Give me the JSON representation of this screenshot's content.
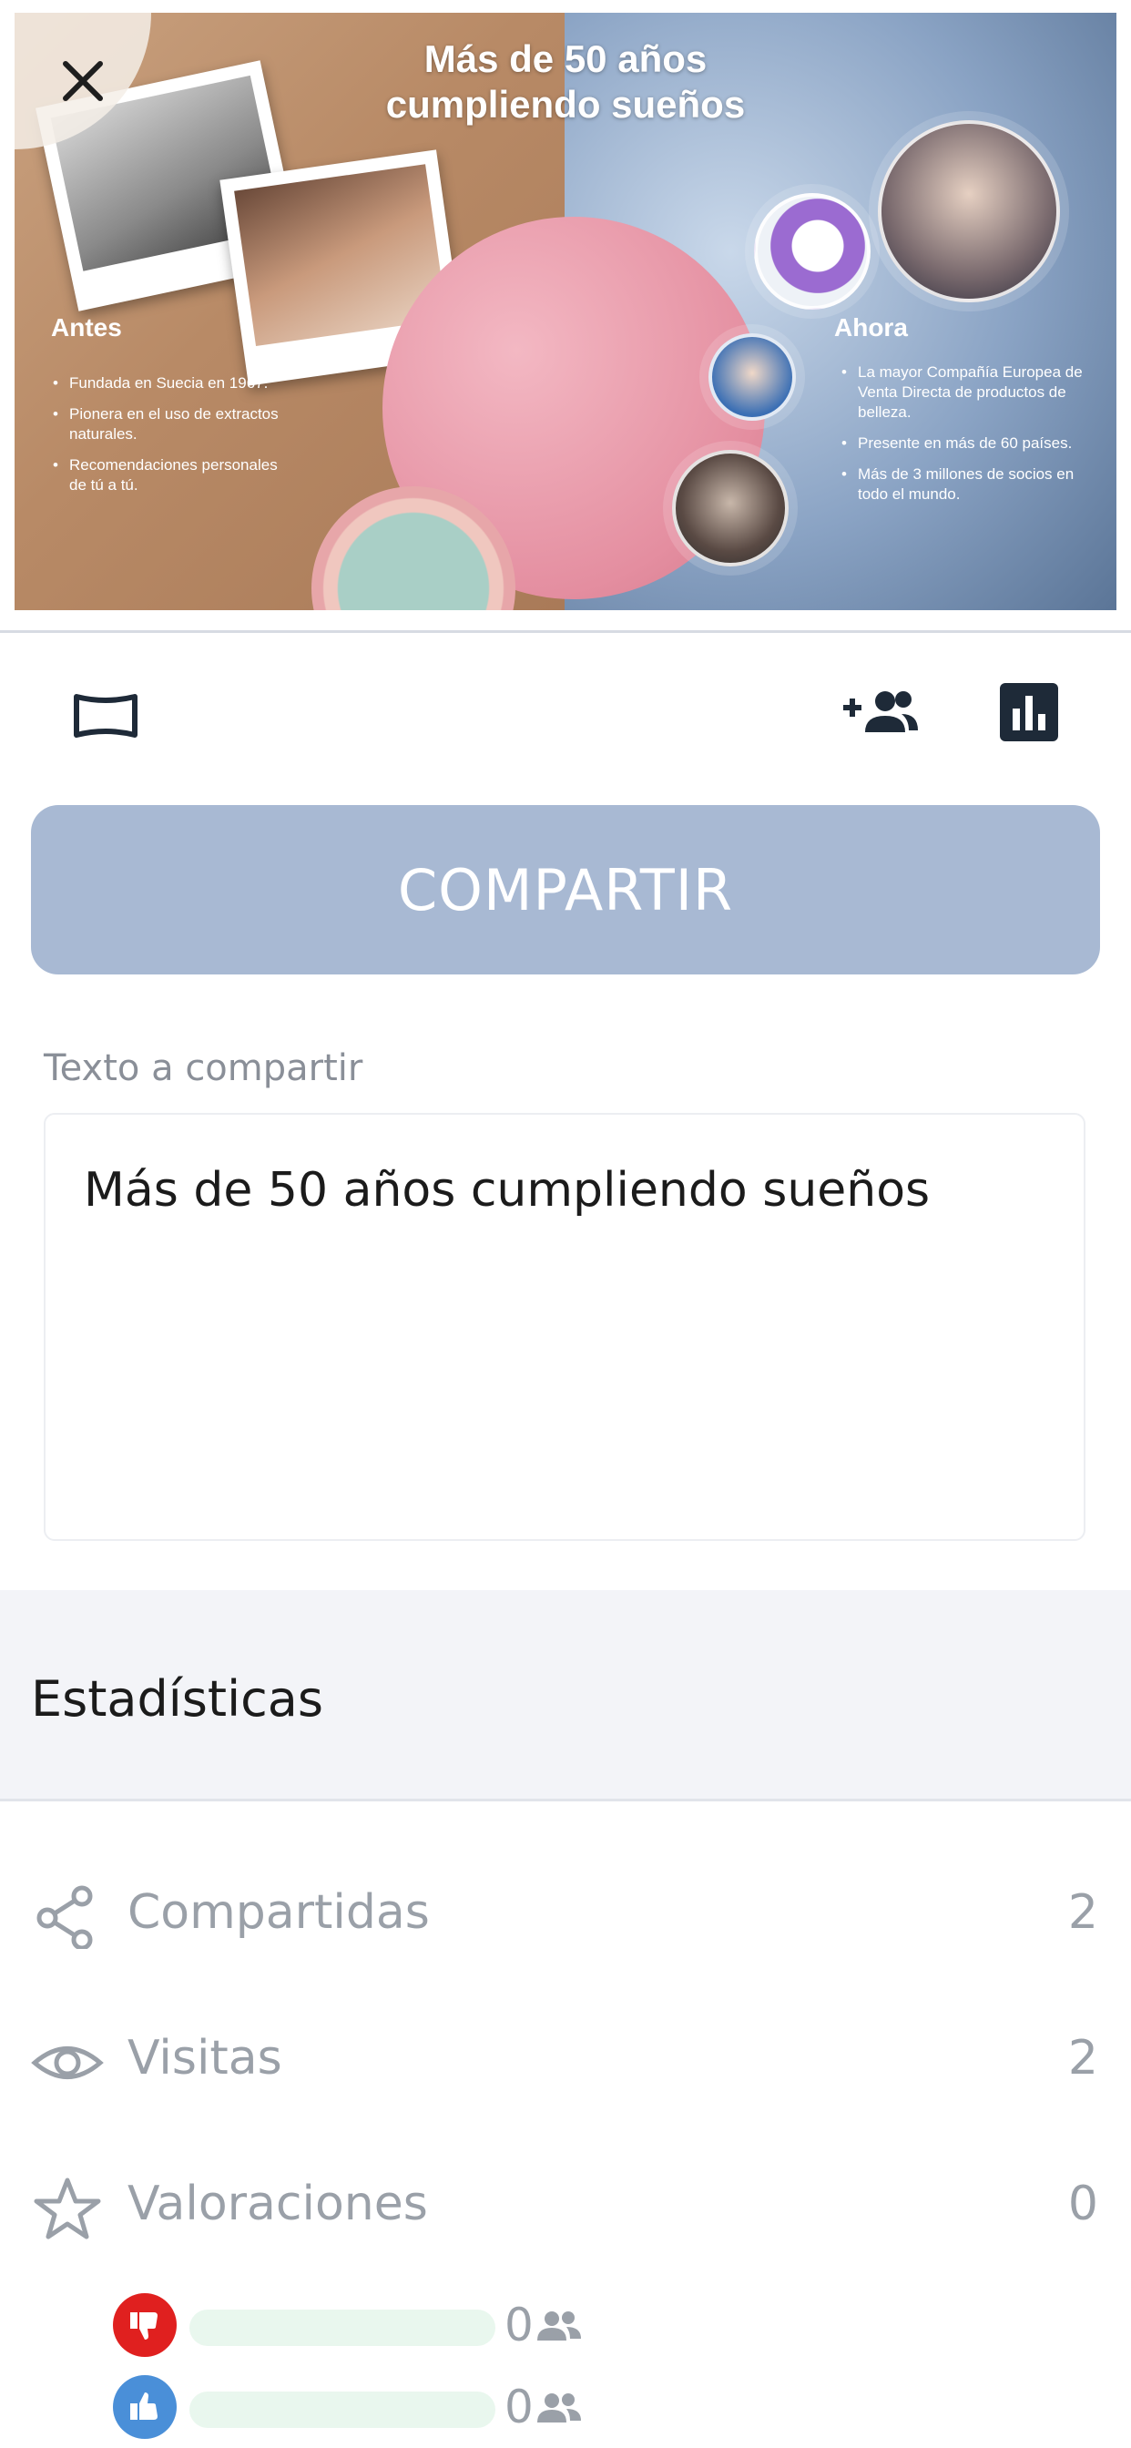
{
  "slide": {
    "title_line1": "Más de 50 años",
    "title_line2": "cumpliendo sueños",
    "antes": {
      "heading": "Antes",
      "items": [
        "Fundada en Suecia en 1967.",
        "Pionera en el uso de extractos naturales.",
        "Recomendaciones personales de tú a tú."
      ]
    },
    "ahora": {
      "heading": "Ahora",
      "items": [
        "La mayor Compañía Europea de Venta Directa de productos de belleza.",
        "Presente en más de 60 países.",
        "Más de 3 millones de socios en todo el mundo."
      ]
    }
  },
  "toolbar": {
    "close_icon": "close-icon",
    "fullscreen_icon": "fullscreen-icon",
    "add_user_icon": "add-user-icon",
    "stats_icon": "bar-chart-icon"
  },
  "share": {
    "button_label": "COMPARTIR",
    "text_label": "Texto a compartir",
    "text_value": "Más de 50 años cumpliendo sueños"
  },
  "stats": {
    "title": "Estadísticas",
    "rows": [
      {
        "label": "Compartidas",
        "value": "2",
        "icon": "share-icon"
      },
      {
        "label": "Visitas",
        "value": "2",
        "icon": "eye-icon"
      },
      {
        "label": "Valoraciones",
        "value": "0",
        "icon": "star-icon"
      }
    ],
    "votes": {
      "dislikes": {
        "count": "0",
        "fraction": 0
      },
      "likes": {
        "count": "0",
        "fraction": 0
      }
    }
  },
  "colors": {
    "share_button": "#a8b9d3",
    "dislike": "#e0201f",
    "like": "#4a8fd8",
    "bar_track": "#e9f7ee"
  }
}
